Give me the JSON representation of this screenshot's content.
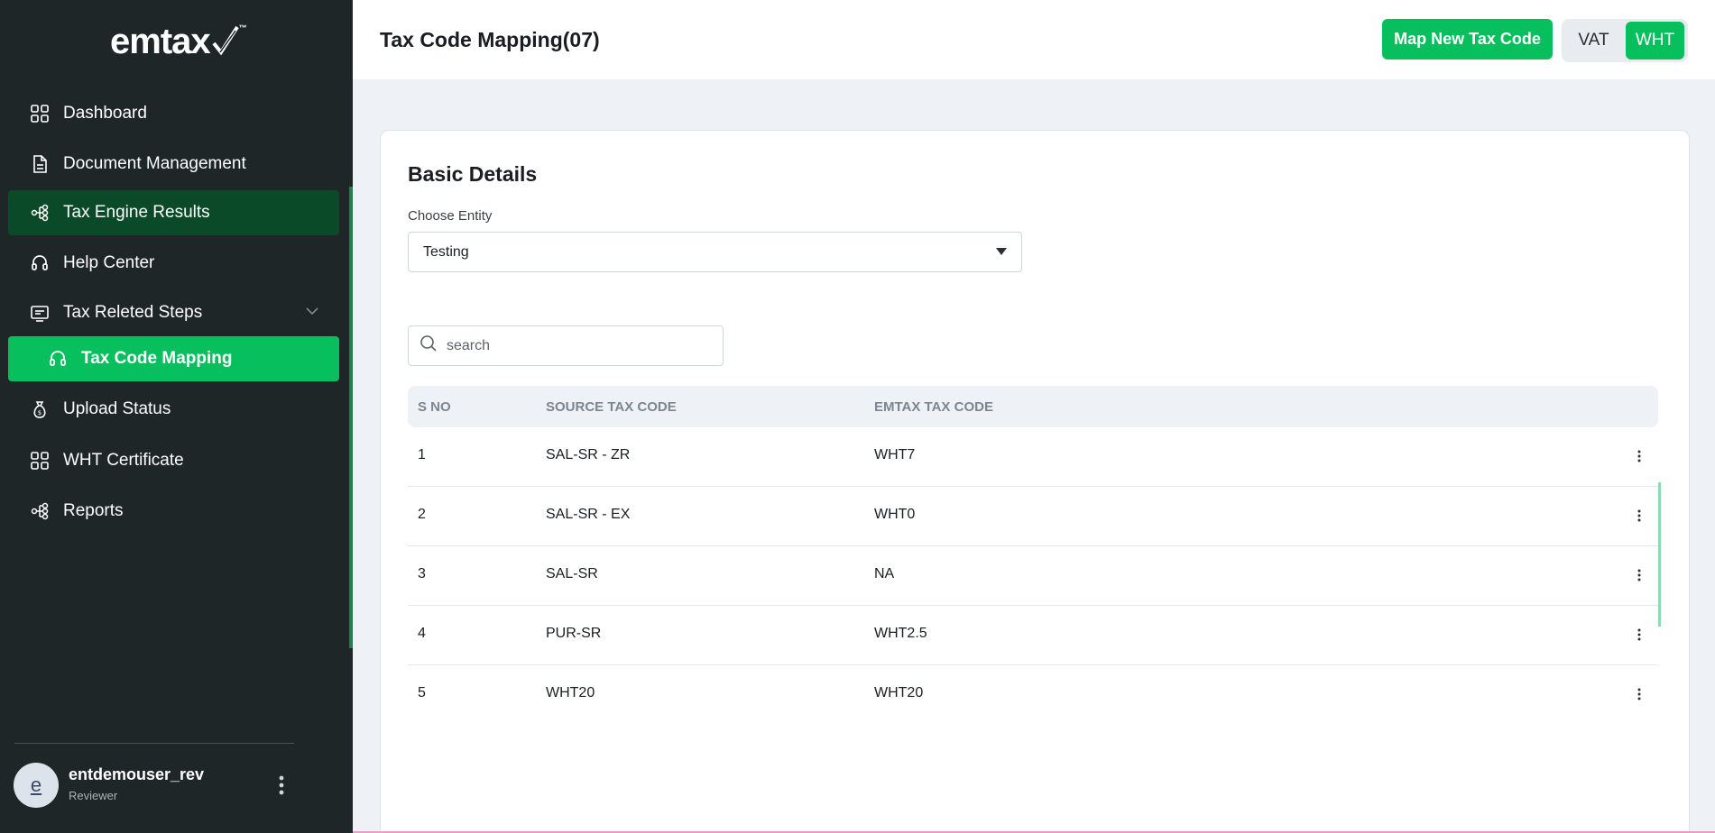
{
  "brand": {
    "logo_text": "emtax",
    "tm": "™"
  },
  "sidebar": {
    "items": [
      {
        "label": "Dashboard",
        "icon": "grid-icon"
      },
      {
        "label": "Document Management",
        "icon": "document-icon"
      },
      {
        "label": "Tax Engine Results",
        "icon": "share-nodes-icon"
      },
      {
        "label": "Help Center",
        "icon": "headset-icon"
      },
      {
        "label": "Tax Releted Steps",
        "icon": "monitor-icon"
      },
      {
        "label": "Tax Code Mapping",
        "icon": "headset-icon"
      },
      {
        "label": "Upload Status",
        "icon": "money-bag-icon"
      },
      {
        "label": "WHT Certificate",
        "icon": "grid-icon"
      },
      {
        "label": "Reports",
        "icon": "share-nodes-icon"
      }
    ]
  },
  "user": {
    "initial": "e",
    "name": "entdemouser_rev",
    "role": "Reviewer"
  },
  "header": {
    "title": "Tax Code Mapping(07)",
    "map_button": "Map New Tax Code",
    "toggle": {
      "vat": "VAT",
      "wht": "WHT",
      "selected": "WHT"
    }
  },
  "card": {
    "title": "Basic Details",
    "entity_label": "Choose Entity",
    "entity_value": "Testing",
    "search_placeholder": "search"
  },
  "table": {
    "headers": [
      "S NO",
      "SOURCE TAX CODE",
      "EMTAX TAX CODE"
    ],
    "rows": [
      {
        "sno": "1",
        "source": "SAL-SR - ZR",
        "emtax": "WHT7"
      },
      {
        "sno": "2",
        "source": "SAL-SR - EX",
        "emtax": "WHT0"
      },
      {
        "sno": "3",
        "source": "SAL-SR",
        "emtax": "NA"
      },
      {
        "sno": "4",
        "source": "PUR-SR",
        "emtax": "WHT2.5"
      },
      {
        "sno": "5",
        "source": "WHT20",
        "emtax": "WHT20"
      }
    ]
  },
  "colors": {
    "accent": "#07bf5d",
    "sidebar_bg": "#1f2627",
    "active_dark": "#0b4a28"
  }
}
